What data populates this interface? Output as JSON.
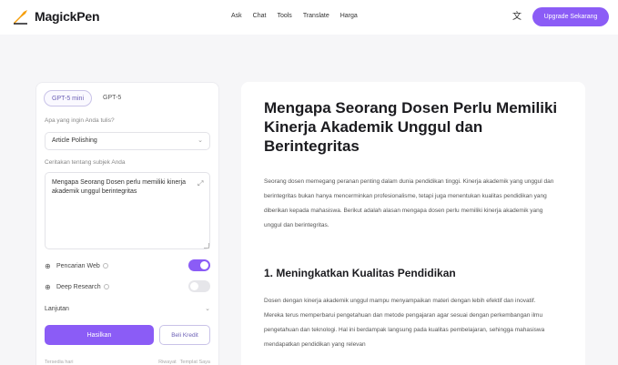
{
  "header": {
    "brand": "MagickPen",
    "nav": [
      "Ask",
      "Chat",
      "Tools",
      "Translate",
      "Harga"
    ],
    "upgrade_label": "Upgrade Sekarang"
  },
  "sidebar": {
    "model_tabs": [
      "GPT-5 mini",
      "GPT-5"
    ],
    "question_label": "Apa yang ingin Anda tulis?",
    "task_select": "Article Polishing",
    "topic_label": "Ceritakan tentang subjek Anda",
    "topic_text": "Mengapa Seorang Dosen perlu memiliki kinerja akademik unggul berintegritas",
    "web_search_label": "Pencarian Web",
    "deep_research_label": "Deep Research",
    "advanced_label": "Lanjutan",
    "generate_label": "Hasilkan",
    "credit_label": "Beli Kredit",
    "footer_left": "Tersedia hari",
    "footer_right": [
      "Riwayat",
      "Templat Saya"
    ]
  },
  "article": {
    "title": "Mengapa Seorang Dosen Perlu Memiliki Kinerja Akademik Unggul dan Berintegritas",
    "intro": "Seorang dosen memegang peranan penting dalam dunia pendidikan tinggi. Kinerja akademik yang unggul dan berintegritas bukan hanya mencerminkan profesionalisme, tetapi juga menentukan kualitas pendidikan yang diberikan kepada mahasiswa. Berikut adalah alasan mengapa dosen perlu memiliki kinerja akademik yang unggul dan berintegritas.",
    "section1_title": "1. Meningkatkan Kualitas Pendidikan",
    "section1_body": "Dosen dengan kinerja akademik unggul mampu menyampaikan materi dengan lebih efektif dan inovatif. Mereka terus memperbarui pengetahuan dan metode pengajaran agar sesuai dengan perkembangan ilmu pengetahuan dan teknologi. Hal ini berdampak langsung pada kualitas pembelajaran, sehingga mahasiswa mendapatkan pendidikan yang relevan"
  },
  "colors": {
    "accent": "#8b5cf6"
  }
}
